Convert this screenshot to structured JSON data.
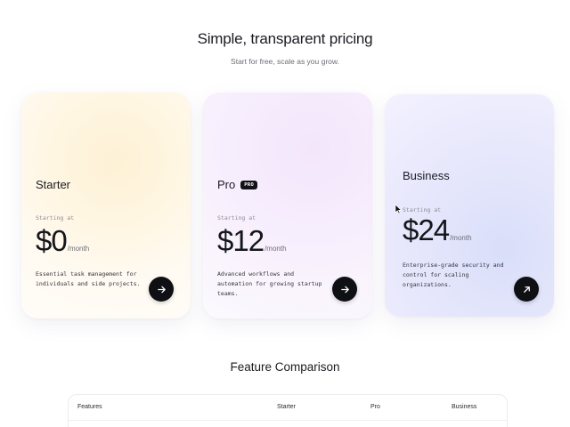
{
  "hero": {
    "title": "Simple, transparent pricing",
    "subtitle": "Start for free, scale as you grow."
  },
  "plans": [
    {
      "name": "Starter",
      "starting_label": "Starting at",
      "price": "$0",
      "period": "/month",
      "description": "Essential task management for individuals and side projects.",
      "button_icon": "arrow-right-icon",
      "accent": "#fdf1d5"
    },
    {
      "name": "Pro",
      "badge": "PRO",
      "starting_label": "Starting at",
      "price": "$12",
      "period": "/month",
      "description": "Advanced workflows and automation for growing startup teams.",
      "button_icon": "arrow-right-icon",
      "accent": "#f3e6fb"
    },
    {
      "name": "Business",
      "starting_label": "Starting at",
      "price": "$24",
      "period": "/month",
      "description": "Enterprise-grade security and control for scaling organizations.",
      "button_icon": "arrow-up-right-icon",
      "accent": "#d9def9"
    }
  ],
  "comparison": {
    "title": "Feature Comparison",
    "headers": [
      "Features",
      "Starter",
      "Pro",
      "Business"
    ]
  },
  "colors": {
    "button": "#0f1013",
    "text": "#15161b",
    "muted": "#6b6d76"
  }
}
